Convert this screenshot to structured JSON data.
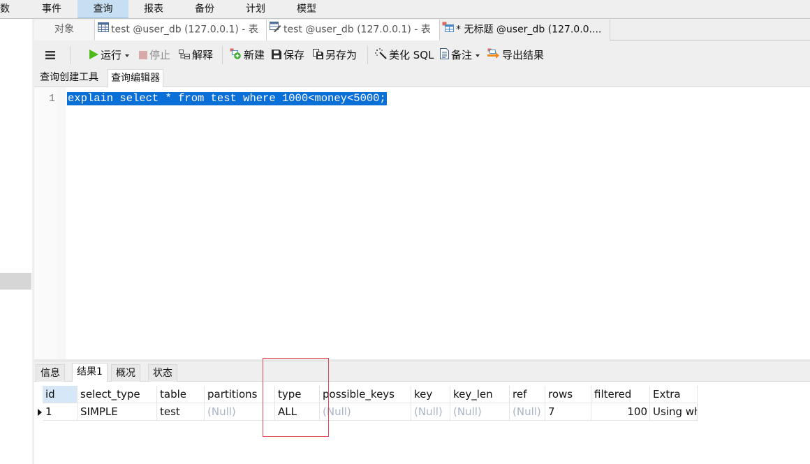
{
  "menubar": {
    "items": [
      {
        "label": "数",
        "active": false
      },
      {
        "label": "事件",
        "active": false
      },
      {
        "label": "查询",
        "active": true
      },
      {
        "label": "报表",
        "active": false
      },
      {
        "label": "备份",
        "active": false
      },
      {
        "label": "计划",
        "active": false
      },
      {
        "label": "模型",
        "active": false
      }
    ]
  },
  "tabs": {
    "objects": "对象",
    "items": [
      {
        "label": "test @user_db (127.0.0.1) - 表",
        "icon": "table-grid-icon"
      },
      {
        "label": "test @user_db (127.0.0.1) - 表",
        "icon": "table-design-icon"
      },
      {
        "label": "* 无标题 @user_db (127.0.0....",
        "icon": "query-icon",
        "active": true
      }
    ]
  },
  "toolbar": {
    "menu_icon": "hamburger-icon",
    "run": "运行",
    "stop": "停止",
    "explain": "解释",
    "new": "新建",
    "save": "保存",
    "save_as": "另存为",
    "beautify": "美化 SQL",
    "comment": "备注",
    "export": "导出结果"
  },
  "editor_tabs": {
    "builder": "查询创建工具",
    "editor": "查询编辑器"
  },
  "editor": {
    "lines": [
      {
        "number": "1",
        "text": "explain select * from test where 1000<money<5000;"
      }
    ]
  },
  "result_tabs": {
    "items": [
      "信息",
      "结果1",
      "概况",
      "状态"
    ],
    "active": "结果1"
  },
  "result_grid": {
    "columns": [
      "id",
      "select_type",
      "table",
      "partitions",
      "type",
      "possible_keys",
      "key",
      "key_len",
      "ref",
      "rows",
      "filtered",
      "Extra"
    ],
    "rows": [
      [
        "1",
        "SIMPLE",
        "test",
        "(Null)",
        "ALL",
        "(Null)",
        "(Null)",
        "(Null)",
        "(Null)",
        "7",
        "100",
        "Using wh"
      ]
    ],
    "highlighted_column": "type",
    "highlight_color": "#e0484f"
  },
  "colors": {
    "selection": "#0a6fd6",
    "menu_active": "#c7dff3",
    "null_text": "#a9b4c6"
  }
}
